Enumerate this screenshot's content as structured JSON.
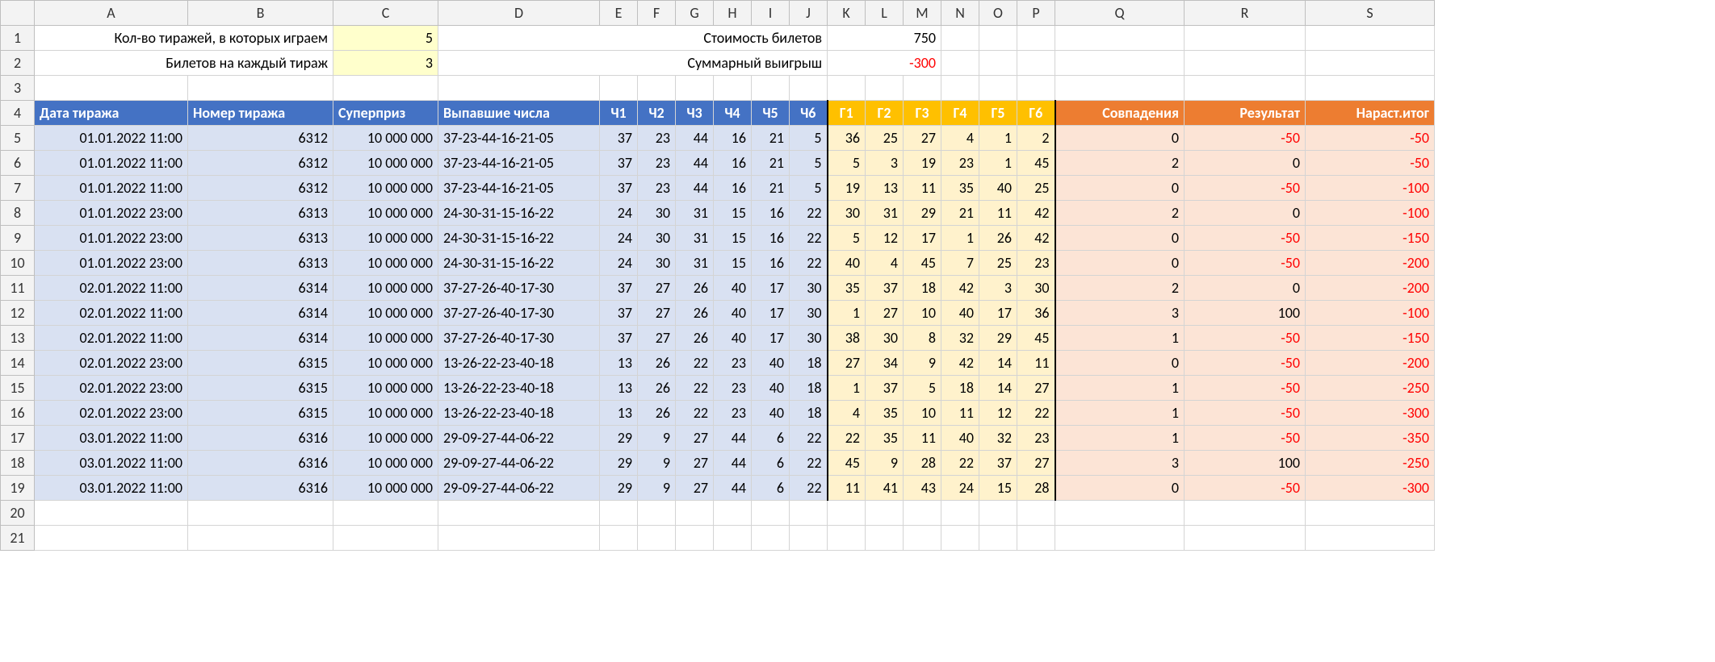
{
  "columns": [
    "A",
    "B",
    "C",
    "D",
    "E",
    "F",
    "G",
    "H",
    "I",
    "J",
    "K",
    "L",
    "M",
    "N",
    "O",
    "P",
    "Q",
    "R",
    "S"
  ],
  "rowCount": 21,
  "labels": {
    "row1_A": "Кол-во тиражей, в которых играем",
    "row1_D": "Стоимость билетов",
    "row2_A": "Билетов на каждый тираж",
    "row2_D": "Суммарный выигрыш"
  },
  "inputs": {
    "drawCount": "5",
    "ticketsPerDraw": "3",
    "ticketCost": "750",
    "totalWin": "-300"
  },
  "header4": {
    "A": "Дата тиража",
    "B": "Номер тиража",
    "C": "Суперприз",
    "D": "Выпавшие числа",
    "E": "Ч1",
    "F": "Ч2",
    "G": "Ч3",
    "H": "Ч4",
    "I": "Ч5",
    "J": "Ч6",
    "K": "Г1",
    "L": "Г2",
    "M": "Г3",
    "N": "Г4",
    "O": "Г5",
    "P": "Г6",
    "Q": "Совпадения",
    "R": "Результат",
    "S": "Нараст.итог"
  },
  "rows": [
    {
      "date": "01.01.2022 11:00",
      "num": "6312",
      "prize": "10 000 000",
      "drawn": "37-23-44-16-21-05",
      "ch": [
        "37",
        "23",
        "44",
        "16",
        "21",
        "5"
      ],
      "g": [
        "36",
        "25",
        "27",
        "4",
        "1",
        "2"
      ],
      "match": "0",
      "res": "-50",
      "cum": "-50"
    },
    {
      "date": "01.01.2022 11:00",
      "num": "6312",
      "prize": "10 000 000",
      "drawn": "37-23-44-16-21-05",
      "ch": [
        "37",
        "23",
        "44",
        "16",
        "21",
        "5"
      ],
      "g": [
        "5",
        "3",
        "19",
        "23",
        "1",
        "45"
      ],
      "match": "2",
      "res": "0",
      "cum": "-50"
    },
    {
      "date": "01.01.2022 11:00",
      "num": "6312",
      "prize": "10 000 000",
      "drawn": "37-23-44-16-21-05",
      "ch": [
        "37",
        "23",
        "44",
        "16",
        "21",
        "5"
      ],
      "g": [
        "19",
        "13",
        "11",
        "35",
        "40",
        "25"
      ],
      "match": "0",
      "res": "-50",
      "cum": "-100"
    },
    {
      "date": "01.01.2022 23:00",
      "num": "6313",
      "prize": "10 000 000",
      "drawn": "24-30-31-15-16-22",
      "ch": [
        "24",
        "30",
        "31",
        "15",
        "16",
        "22"
      ],
      "g": [
        "30",
        "31",
        "29",
        "21",
        "11",
        "42"
      ],
      "match": "2",
      "res": "0",
      "cum": "-100"
    },
    {
      "date": "01.01.2022 23:00",
      "num": "6313",
      "prize": "10 000 000",
      "drawn": "24-30-31-15-16-22",
      "ch": [
        "24",
        "30",
        "31",
        "15",
        "16",
        "22"
      ],
      "g": [
        "5",
        "12",
        "17",
        "1",
        "26",
        "42"
      ],
      "match": "0",
      "res": "-50",
      "cum": "-150"
    },
    {
      "date": "01.01.2022 23:00",
      "num": "6313",
      "prize": "10 000 000",
      "drawn": "24-30-31-15-16-22",
      "ch": [
        "24",
        "30",
        "31",
        "15",
        "16",
        "22"
      ],
      "g": [
        "40",
        "4",
        "45",
        "7",
        "25",
        "23"
      ],
      "match": "0",
      "res": "-50",
      "cum": "-200"
    },
    {
      "date": "02.01.2022 11:00",
      "num": "6314",
      "prize": "10 000 000",
      "drawn": "37-27-26-40-17-30",
      "ch": [
        "37",
        "27",
        "26",
        "40",
        "17",
        "30"
      ],
      "g": [
        "35",
        "37",
        "18",
        "42",
        "3",
        "30"
      ],
      "match": "2",
      "res": "0",
      "cum": "-200"
    },
    {
      "date": "02.01.2022 11:00",
      "num": "6314",
      "prize": "10 000 000",
      "drawn": "37-27-26-40-17-30",
      "ch": [
        "37",
        "27",
        "26",
        "40",
        "17",
        "30"
      ],
      "g": [
        "1",
        "27",
        "10",
        "40",
        "17",
        "36"
      ],
      "match": "3",
      "res": "100",
      "cum": "-100"
    },
    {
      "date": "02.01.2022 11:00",
      "num": "6314",
      "prize": "10 000 000",
      "drawn": "37-27-26-40-17-30",
      "ch": [
        "37",
        "27",
        "26",
        "40",
        "17",
        "30"
      ],
      "g": [
        "38",
        "30",
        "8",
        "32",
        "29",
        "45"
      ],
      "match": "1",
      "res": "-50",
      "cum": "-150"
    },
    {
      "date": "02.01.2022 23:00",
      "num": "6315",
      "prize": "10 000 000",
      "drawn": "13-26-22-23-40-18",
      "ch": [
        "13",
        "26",
        "22",
        "23",
        "40",
        "18"
      ],
      "g": [
        "27",
        "34",
        "9",
        "42",
        "14",
        "11"
      ],
      "match": "0",
      "res": "-50",
      "cum": "-200"
    },
    {
      "date": "02.01.2022 23:00",
      "num": "6315",
      "prize": "10 000 000",
      "drawn": "13-26-22-23-40-18",
      "ch": [
        "13",
        "26",
        "22",
        "23",
        "40",
        "18"
      ],
      "g": [
        "1",
        "37",
        "5",
        "18",
        "14",
        "27"
      ],
      "match": "1",
      "res": "-50",
      "cum": "-250"
    },
    {
      "date": "02.01.2022 23:00",
      "num": "6315",
      "prize": "10 000 000",
      "drawn": "13-26-22-23-40-18",
      "ch": [
        "13",
        "26",
        "22",
        "23",
        "40",
        "18"
      ],
      "g": [
        "4",
        "35",
        "10",
        "11",
        "12",
        "22"
      ],
      "match": "1",
      "res": "-50",
      "cum": "-300"
    },
    {
      "date": "03.01.2022 11:00",
      "num": "6316",
      "prize": "10 000 000",
      "drawn": "29-09-27-44-06-22",
      "ch": [
        "29",
        "9",
        "27",
        "44",
        "6",
        "22"
      ],
      "g": [
        "22",
        "35",
        "11",
        "40",
        "32",
        "23"
      ],
      "match": "1",
      "res": "-50",
      "cum": "-350"
    },
    {
      "date": "03.01.2022 11:00",
      "num": "6316",
      "prize": "10 000 000",
      "drawn": "29-09-27-44-06-22",
      "ch": [
        "29",
        "9",
        "27",
        "44",
        "6",
        "22"
      ],
      "g": [
        "45",
        "9",
        "28",
        "22",
        "37",
        "27"
      ],
      "match": "3",
      "res": "100",
      "cum": "-250"
    },
    {
      "date": "03.01.2022 11:00",
      "num": "6316",
      "prize": "10 000 000",
      "drawn": "29-09-27-44-06-22",
      "ch": [
        "29",
        "9",
        "27",
        "44",
        "6",
        "22"
      ],
      "g": [
        "11",
        "41",
        "43",
        "24",
        "15",
        "28"
      ],
      "match": "0",
      "res": "-50",
      "cum": "-300"
    }
  ]
}
